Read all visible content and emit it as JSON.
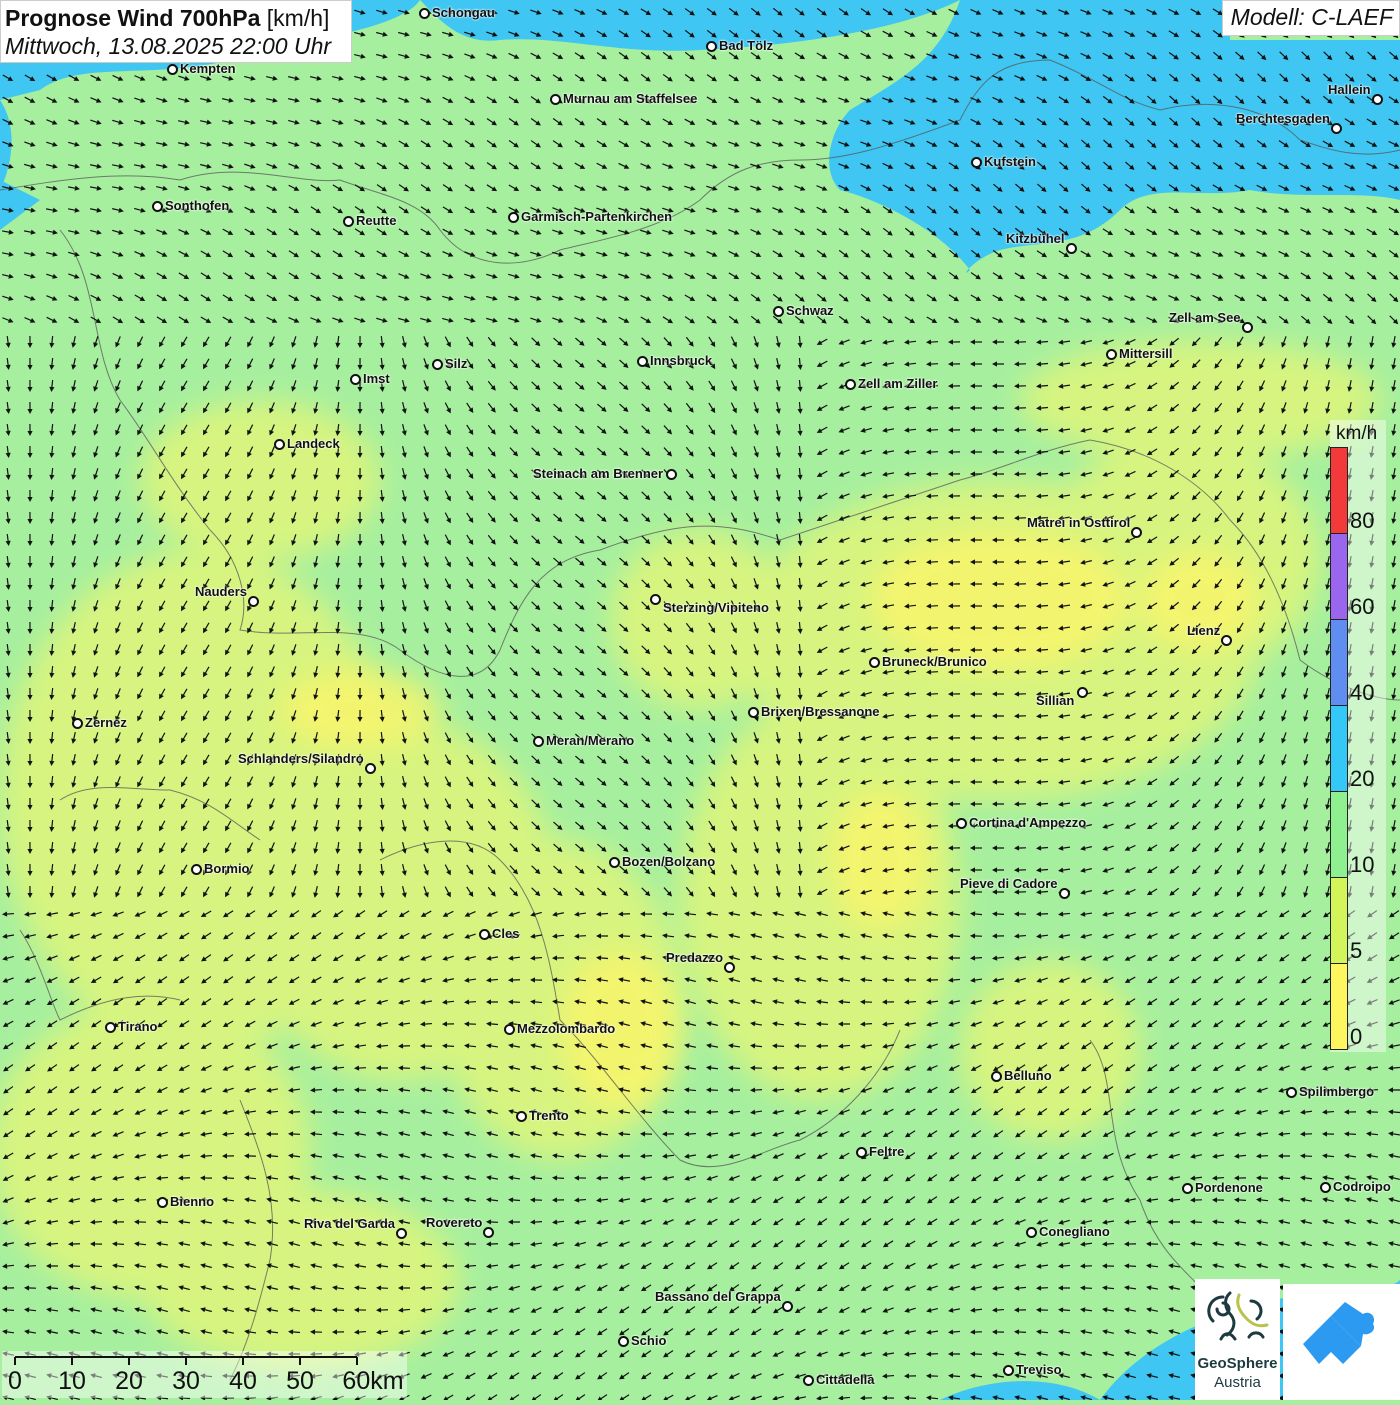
{
  "header": {
    "title_bold": "Prognose Wind 700hPa",
    "title_unit": "[km/h]",
    "datetime": "Mittwoch, 13.08.2025 22:00 Uhr",
    "model": "Modell: C-LAEF"
  },
  "legend": {
    "unit": "km/h",
    "bins": [
      {
        "label": "0",
        "color": "#fdf65e"
      },
      {
        "label": "5",
        "color": "#d4f55a"
      },
      {
        "label": "10",
        "color": "#8ef08e"
      },
      {
        "label": "20",
        "color": "#33c8f5"
      },
      {
        "label": "40",
        "color": "#5f8df0"
      },
      {
        "label": "60",
        "color": "#9a66ee"
      },
      {
        "label": "80",
        "color": "#f33a3a"
      }
    ]
  },
  "scale_bar": {
    "labels": [
      "0",
      "10",
      "20",
      "30",
      "40",
      "50",
      "60km"
    ]
  },
  "logos": {
    "geosphere_line1": "GeoSphere",
    "geosphere_line2": "Austria"
  },
  "cities": [
    "Schongau",
    "Bad Tölz",
    "Kempten",
    "Murnau am Staffelsee",
    "Hallein",
    "Berchtesgaden",
    "Kufstein",
    "Sonthofen",
    "Reutte",
    "Garmisch-Partenkirchen",
    "Kitzbühel",
    "Schwaz",
    "Zell am See",
    "Innsbruck",
    "Mittersill",
    "Silz",
    "Imst",
    "Zell am Ziller",
    "Landeck",
    "Steinach am Brenner",
    "Matrei in Osttirol",
    "Nauders",
    "Sterzing/Vipiteno",
    "Lienz",
    "Bruneck/Brunico",
    "Sillian",
    "Brixen/Bressanone",
    "Zernez",
    "Meran/Merano",
    "Schlanders/Silandro",
    "Cortina d'Ampezzo",
    "Bozen/Bolzano",
    "Bormio",
    "Pieve di Cadore",
    "Cles",
    "Predazzo",
    "Tirano",
    "Mezzolombardo",
    "Belluno",
    "Spilimbergo",
    "Trento",
    "Feltre",
    "Pordenone",
    "Codroipo",
    "Bienno",
    "Riva del Garda",
    "Rovereto",
    "Conegliano",
    "Bassano del Grappa",
    "Schio",
    "Treviso",
    "Cittadella"
  ]
}
